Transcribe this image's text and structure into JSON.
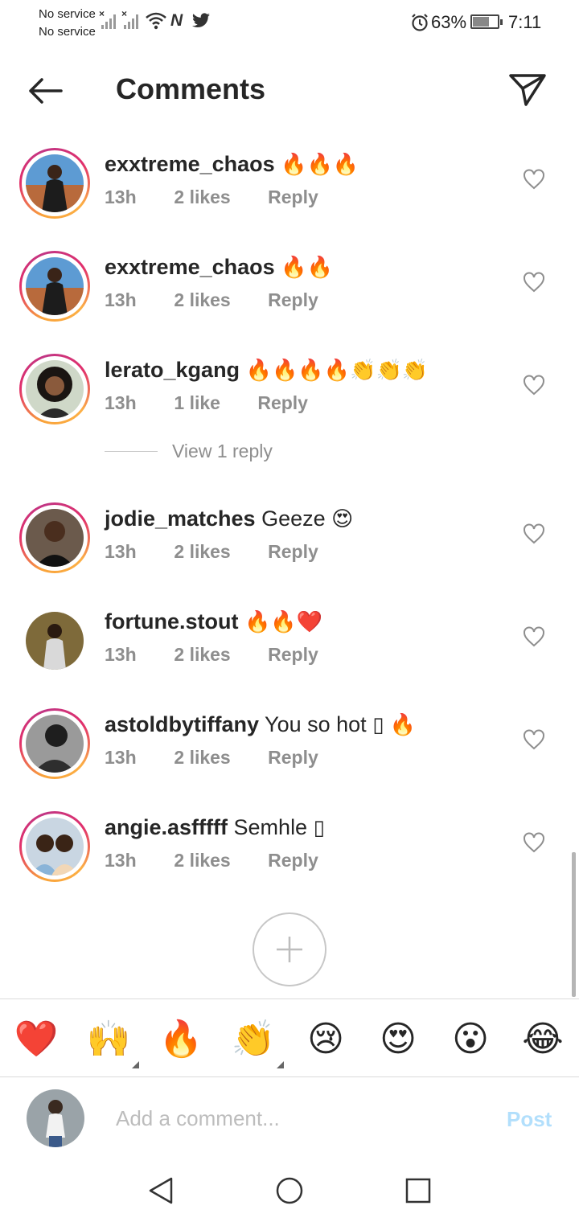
{
  "status_bar": {
    "carrier_1": "No service",
    "carrier_2": "No service",
    "battery": "63%",
    "battery_level": 0.63,
    "time": "7:11",
    "icons": [
      "signal-icon",
      "signal-icon",
      "wifi-icon",
      "nfc-icon",
      "twitter-icon",
      "alarm-icon",
      "battery-icon"
    ]
  },
  "header": {
    "title": "Comments",
    "back_icon": "arrow-left-icon",
    "send_icon": "paper-plane-icon"
  },
  "comments": [
    {
      "username": "exxtreme_chaos",
      "text": "",
      "emoji": "🔥🔥🔥",
      "time": "13h",
      "likes": "2 likes",
      "reply": "Reply"
    },
    {
      "username": "exxtreme_chaos",
      "text": "",
      "emoji": "🔥🔥",
      "time": "13h",
      "likes": "2 likes",
      "reply": "Reply"
    },
    {
      "username": "lerato_kgang",
      "text": "",
      "emoji": "🔥🔥🔥🔥👏👏👏",
      "time": "13h",
      "likes": "1 like",
      "reply": "Reply"
    },
    {
      "username": "jodie_matches",
      "text": "Geeze",
      "emoji": "😍",
      "time": "13h",
      "likes": "2 likes",
      "reply": "Reply"
    },
    {
      "username": "fortune.stout",
      "text": "",
      "emoji": "🔥🔥❤️",
      "time": "13h",
      "likes": "2 likes",
      "reply": "Reply"
    },
    {
      "username": "astoldbytiffany",
      "text": "You so hot",
      "emoji": "▯ 🔥",
      "time": "13h",
      "likes": "2 likes",
      "reply": "Reply"
    },
    {
      "username": "angie.asfffff",
      "text": "Semhle",
      "emoji": "▯",
      "time": "13h",
      "likes": "2 likes",
      "reply": "Reply"
    }
  ],
  "view_replies": "View 1 reply",
  "quick_emojis": [
    "❤️",
    "🙌",
    "🔥",
    "👏",
    "😢",
    "😍",
    "😮",
    "😂"
  ],
  "composer": {
    "placeholder": "Add a comment...",
    "post_label": "Post"
  },
  "nav_bar": {
    "icons": [
      "nav-back-icon",
      "nav-home-icon",
      "nav-recents-icon"
    ]
  },
  "colors": {
    "text": "#262626",
    "meta": "#8e8e8e",
    "post_disabled": "#b2dffc",
    "ring_start": "#f9a33a",
    "ring_end": "#c13584"
  }
}
